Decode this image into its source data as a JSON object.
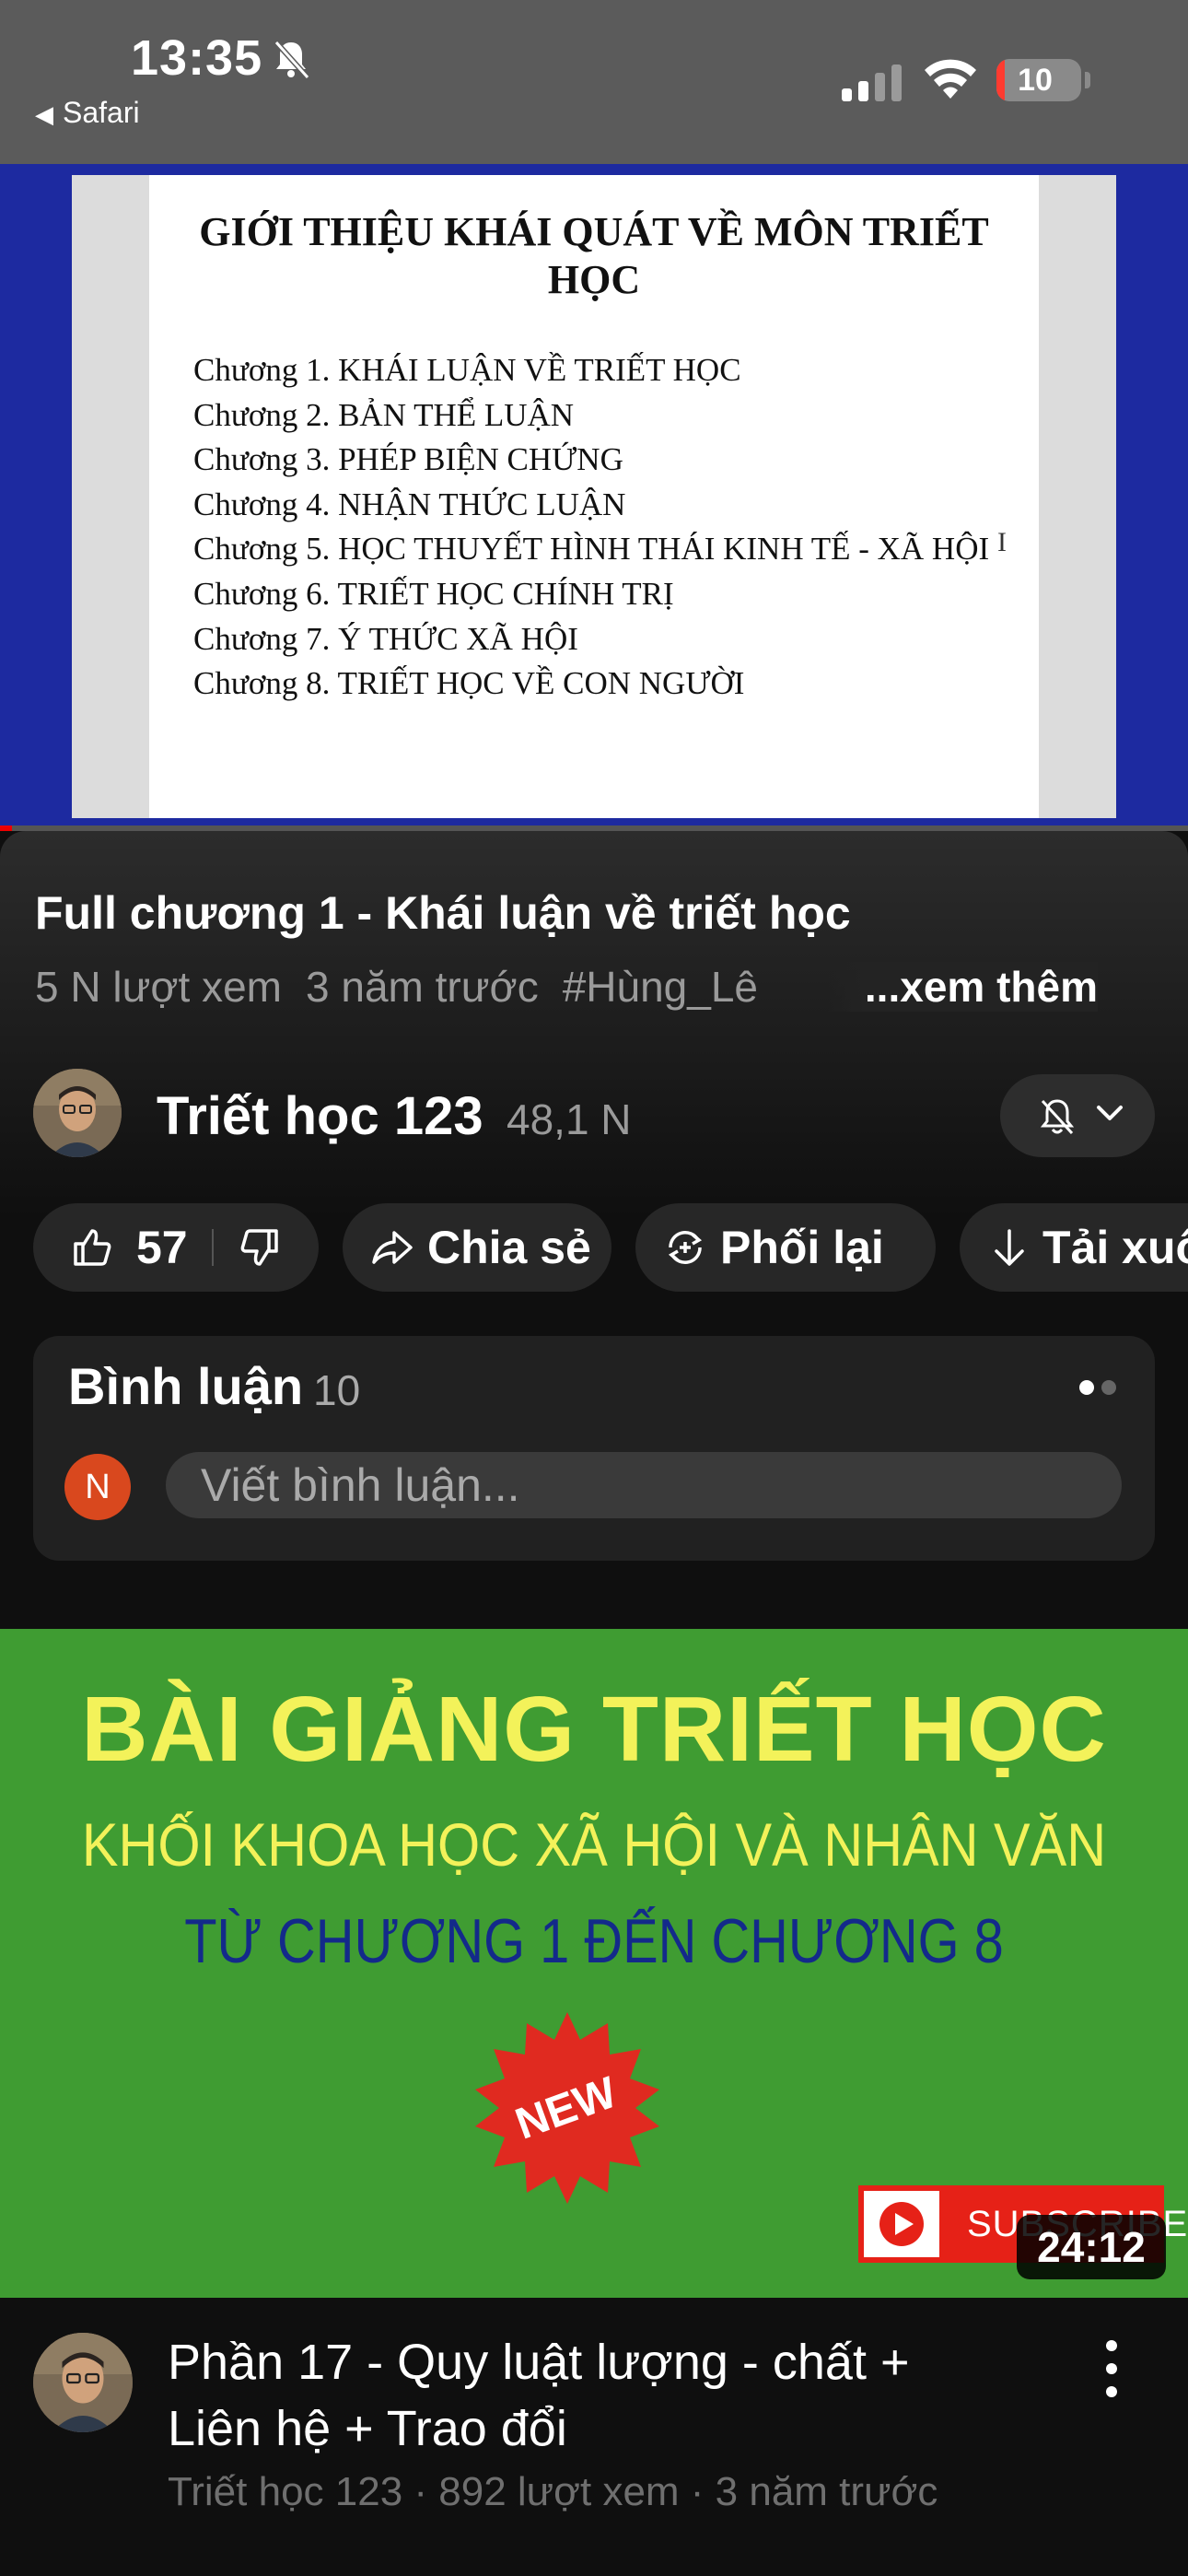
{
  "status_bar": {
    "time": "13:35",
    "back_app": "Safari",
    "battery": "10"
  },
  "player": {
    "slide_title": "GIỚI THIỆU KHÁI QUÁT VỀ MÔN TRIẾT HỌC",
    "slide_items": [
      "Chương 1. KHÁI LUẬN VỀ TRIẾT HỌC",
      "Chương 2. BẢN THỂ LUẬN",
      "Chương 3. PHÉP BIỆN CHỨNG",
      "Chương 4. NHẬN THỨC LUẬN",
      "Chương 5. HỌC THUYẾT HÌNH THÁI KINH TẾ - XÃ HỘI",
      "Chương 6. TRIẾT HỌC CHÍNH TRỊ",
      "Chương 7. Ý THỨC XÃ HỘI",
      "Chương 8. TRIẾT HỌC VỀ CON NGƯỜI"
    ],
    "cursor_glyph": "I"
  },
  "video": {
    "title": "Full chương 1 - Khái luận về triết học",
    "views": "5 N lượt xem",
    "age": "3 năm trước",
    "hashtag": "#Hùng_Lê",
    "more": "...xem thêm"
  },
  "channel": {
    "name": "Triết học 123",
    "subscribers": "48,1 N"
  },
  "actions": {
    "likes": "57",
    "share": "Chia sẻ",
    "remix": "Phối lại",
    "download": "Tải xuống"
  },
  "comments": {
    "title": "Bình luận",
    "count": "10",
    "avatar_letter": "N",
    "placeholder": "Viết bình luận..."
  },
  "next_video": {
    "thumb_line1": "BÀI GIẢNG TRIẾT HỌC",
    "thumb_line2": "KHỐI KHOA HỌC XÃ HỘI VÀ NHÂN VĂN",
    "thumb_line3": "TỪ CHƯƠNG 1 ĐẾN CHƯƠNG 8",
    "thumb_badge": "NEW",
    "thumb_subscribe": "SUBSCRIBE",
    "duration": "24:12",
    "title": "Phần 17 - Quy luật lượng - chất + Liên hệ + Trao đổi",
    "meta": "Triết học 123 · 892 lượt xem · 3 năm trước"
  },
  "colors": {
    "accent_red": "#ff0000",
    "player_bg": "#1d2aa0",
    "thumb_green": "#3f9c32",
    "comment_avatar": "#d9481e"
  }
}
